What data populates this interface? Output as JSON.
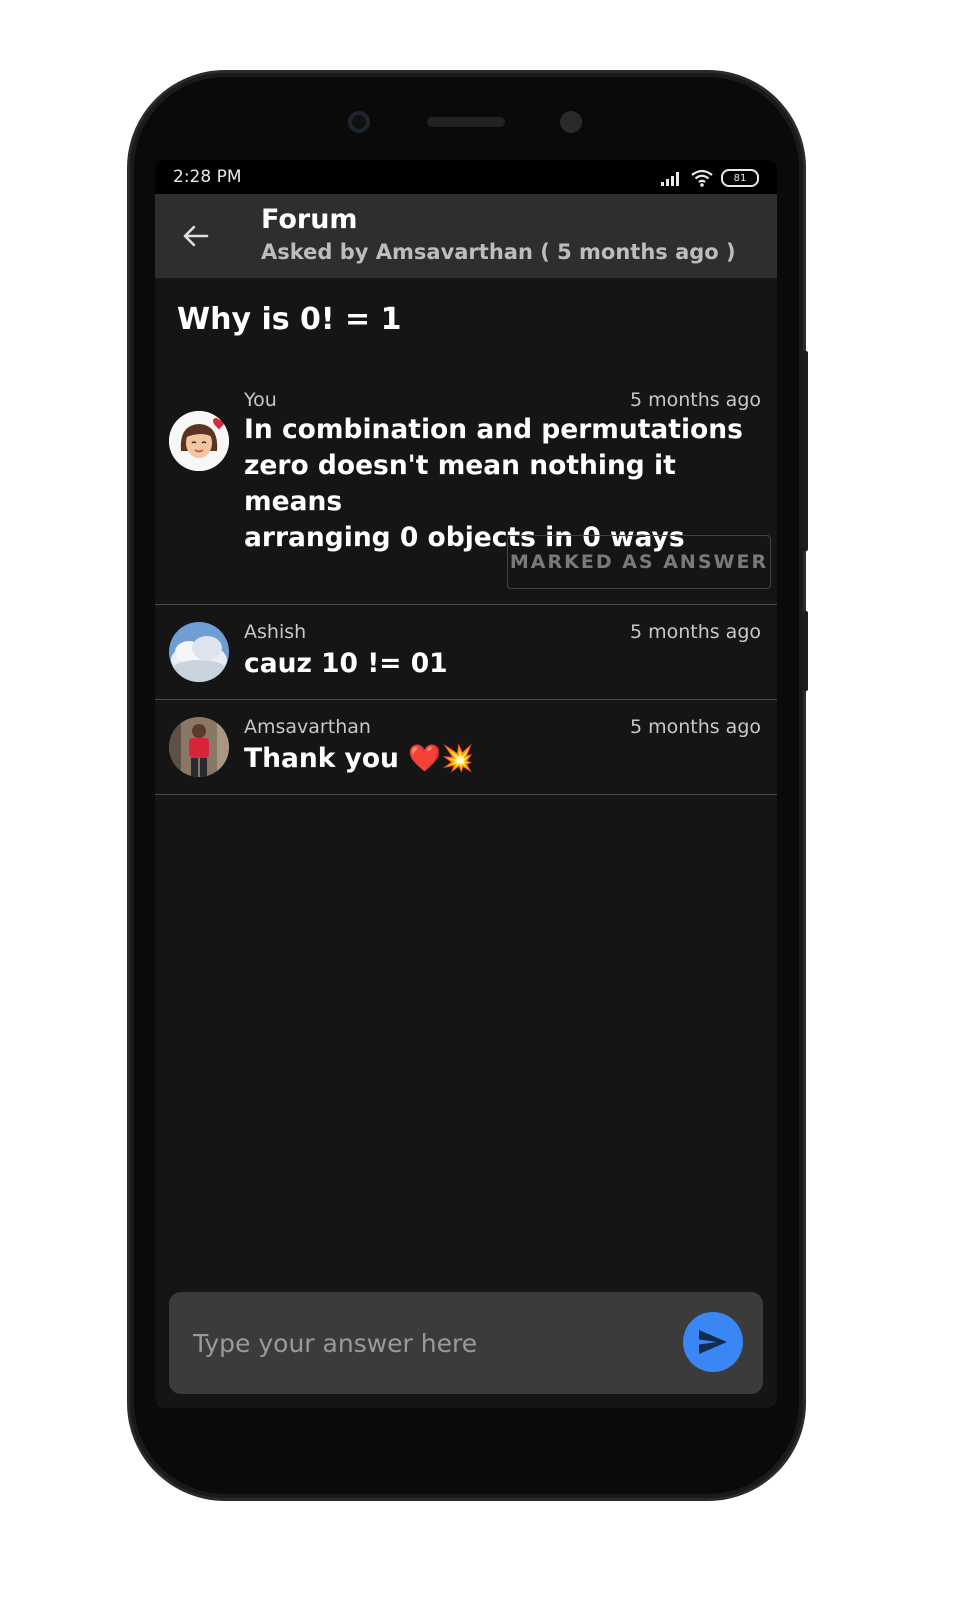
{
  "status_bar": {
    "time": "2:28 PM",
    "battery": "81"
  },
  "app_bar": {
    "title": "Forum",
    "subtitle": "Asked by Amsavarthan ( 5 months ago )"
  },
  "question": "Why is 0! = 1",
  "answers": [
    {
      "author": "You",
      "time": "5 months ago",
      "text_lines": [
        "In combination and permutations",
        "zero doesn't mean nothing it means",
        "arranging 0 objects in 0 ways"
      ],
      "badge": "MARKED AS ANSWER"
    },
    {
      "author": "Ashish",
      "time": "5 months ago",
      "text": "cauz 10 != 01"
    },
    {
      "author": "Amsavarthan",
      "time": "5 months ago",
      "text": "Thank you ❤️💥"
    }
  ],
  "composer": {
    "placeholder": "Type your answer here"
  },
  "colors": {
    "accent": "#3a86f5",
    "background": "#151515",
    "appbar": "#2e2e2e"
  }
}
